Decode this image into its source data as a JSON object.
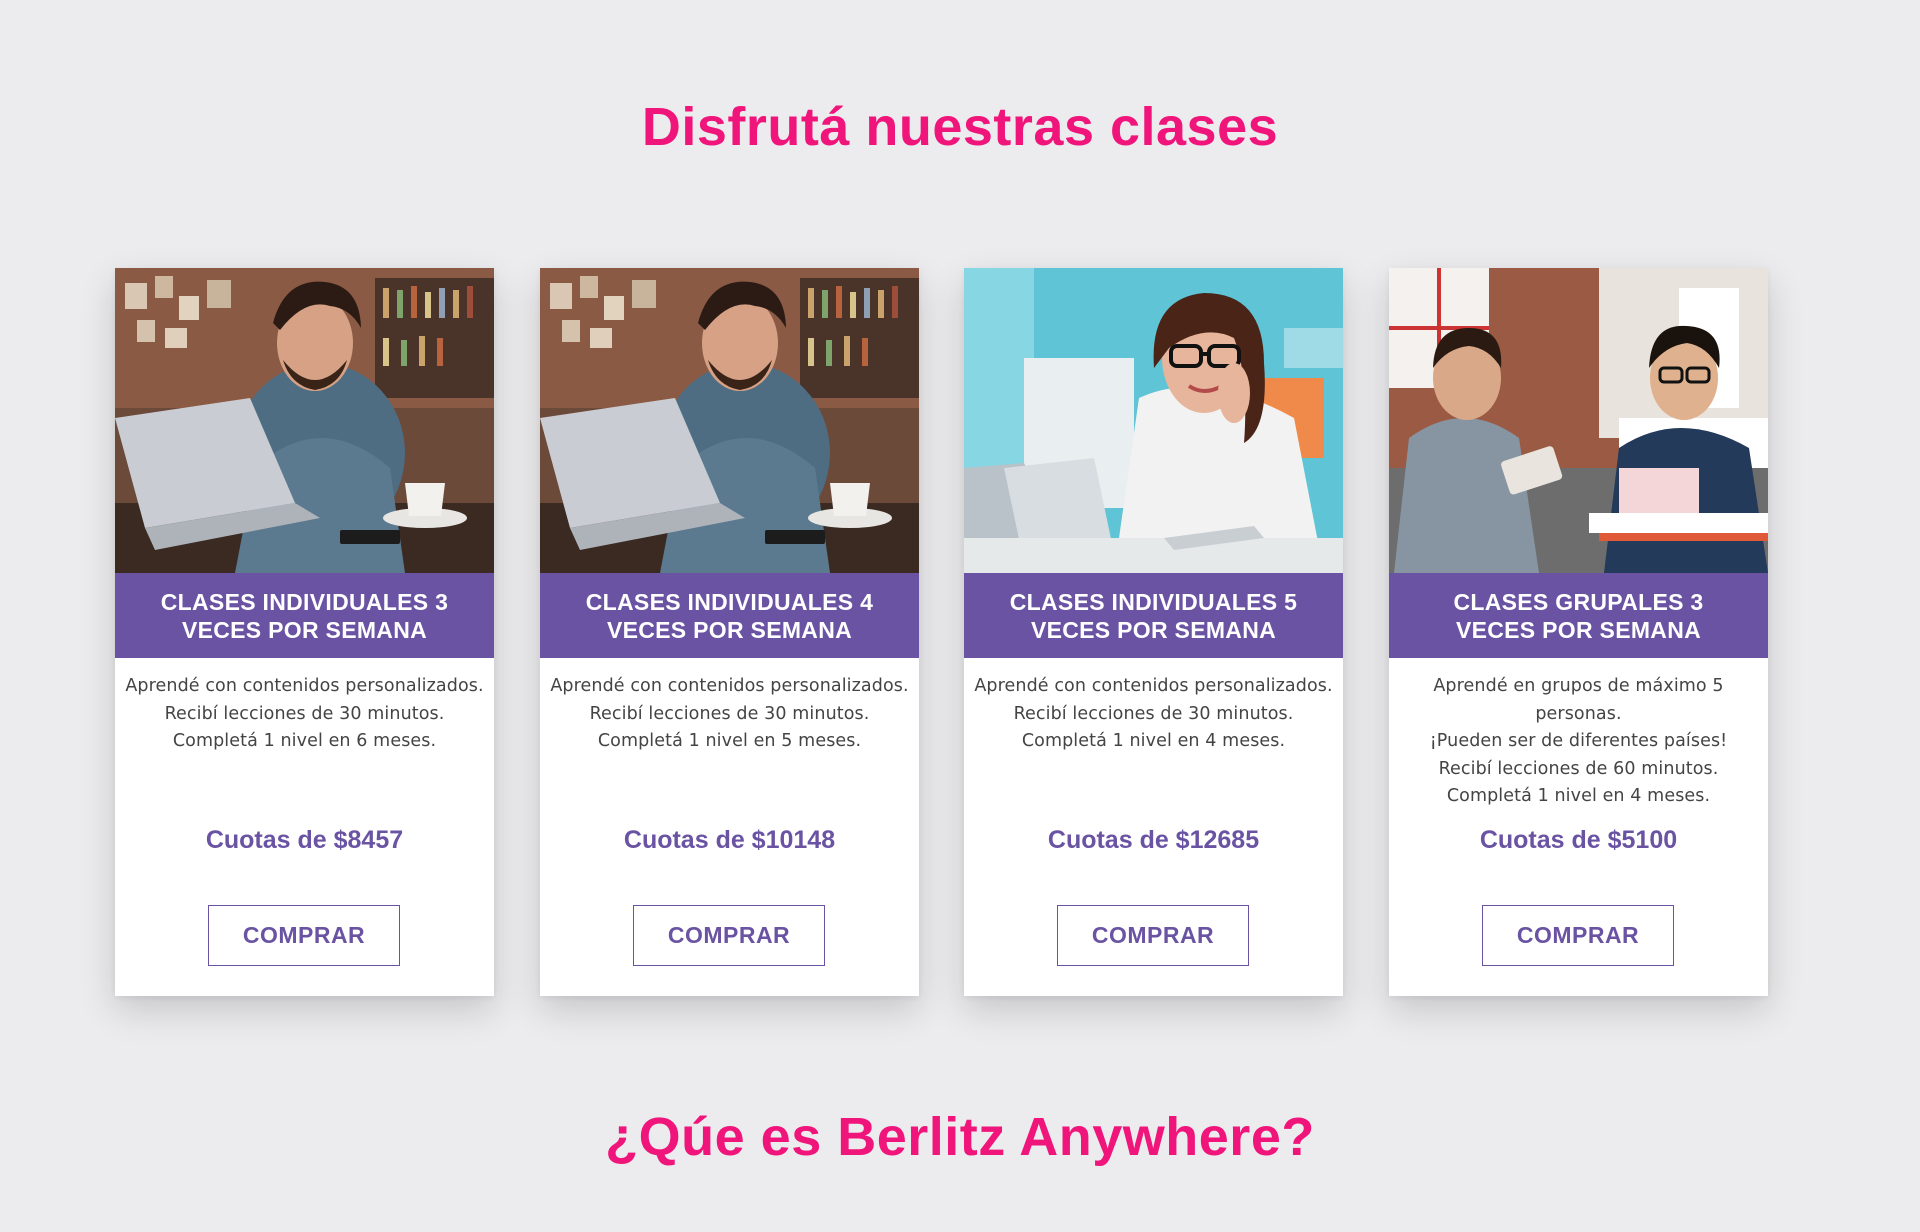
{
  "header": {
    "title": "Disfrutá nuestras clases"
  },
  "plans": [
    {
      "title": "CLASES INDIVIDUALES 3 VECES POR SEMANA",
      "description": [
        "Aprendé con contenidos personalizados.",
        "Recibí lecciones de 30 minutos.",
        "Completá 1 nivel en 6 meses."
      ],
      "price": "Cuotas de $8457",
      "button": "COMPRAR",
      "image": "man-laptop-cafe-photo"
    },
    {
      "title": "CLASES INDIVIDUALES 4 VECES POR SEMANA",
      "description": [
        "Aprendé con contenidos personalizados.",
        "Recibí lecciones de 30 minutos.",
        "Completá 1 nivel en 5 meses."
      ],
      "price": "Cuotas de $10148",
      "button": "COMPRAR",
      "image": "man-laptop-cafe-photo"
    },
    {
      "title": "CLASES INDIVIDUALES 5 VECES POR SEMANA",
      "description": [
        "Aprendé con contenidos personalizados.",
        "Recibí lecciones de 30 minutos.",
        "Completá 1 nivel en 4 meses."
      ],
      "price": "Cuotas de $12685",
      "button": "COMPRAR",
      "image": "woman-laptop-office-photo"
    },
    {
      "title": "CLASES GRUPALES 3 VECES POR SEMANA",
      "description": [
        "Aprendé en grupos de máximo 5 personas.",
        "¡Pueden ser de diferentes países!",
        "Recibí lecciones de 60 minutos.",
        "Completá 1 nivel en 4 meses."
      ],
      "price": "Cuotas de $5100",
      "button": "COMPRAR",
      "image": "two-men-tablet-photo"
    }
  ],
  "footer": {
    "title": "¿Qúe es Berlitz Anywhere?"
  },
  "colors": {
    "accent_pink": "#f0157a",
    "brand_purple": "#6a53a3",
    "background": "#ececee"
  }
}
